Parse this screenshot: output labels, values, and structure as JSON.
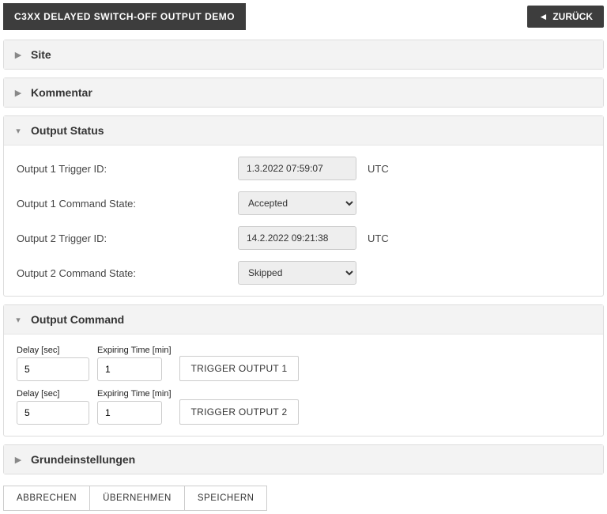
{
  "header": {
    "title": "C3XX DELAYED SWITCH-OFF OUTPUT DEMO",
    "back_label": "ZURÜCK"
  },
  "panels": {
    "site": {
      "title": "Site"
    },
    "kommentar": {
      "title": "Kommentar"
    },
    "output_status": {
      "title": "Output Status",
      "rows": {
        "o1_trigger": {
          "label": "Output 1 Trigger ID:",
          "value": "1.3.2022 07:59:07",
          "suffix": "UTC"
        },
        "o1_state": {
          "label": "Output 1 Command State:",
          "value": "Accepted"
        },
        "o2_trigger": {
          "label": "Output 2 Trigger ID:",
          "value": "14.2.2022 09:21:38",
          "suffix": "UTC"
        },
        "o2_state": {
          "label": "Output 2 Command State:",
          "value": "Skipped"
        }
      }
    },
    "output_command": {
      "title": "Output Command",
      "labels": {
        "delay": "Delay [sec]",
        "expire": "Expiring Time [min]"
      },
      "rows": [
        {
          "delay": "5",
          "expire": "1",
          "button": "TRIGGER OUTPUT 1"
        },
        {
          "delay": "5",
          "expire": "1",
          "button": "TRIGGER OUTPUT 2"
        }
      ]
    },
    "grund": {
      "title": "Grundeinstellungen"
    }
  },
  "footer": {
    "cancel": "ABBRECHEN",
    "apply": "ÜBERNEHMEN",
    "save": "SPEICHERN"
  }
}
